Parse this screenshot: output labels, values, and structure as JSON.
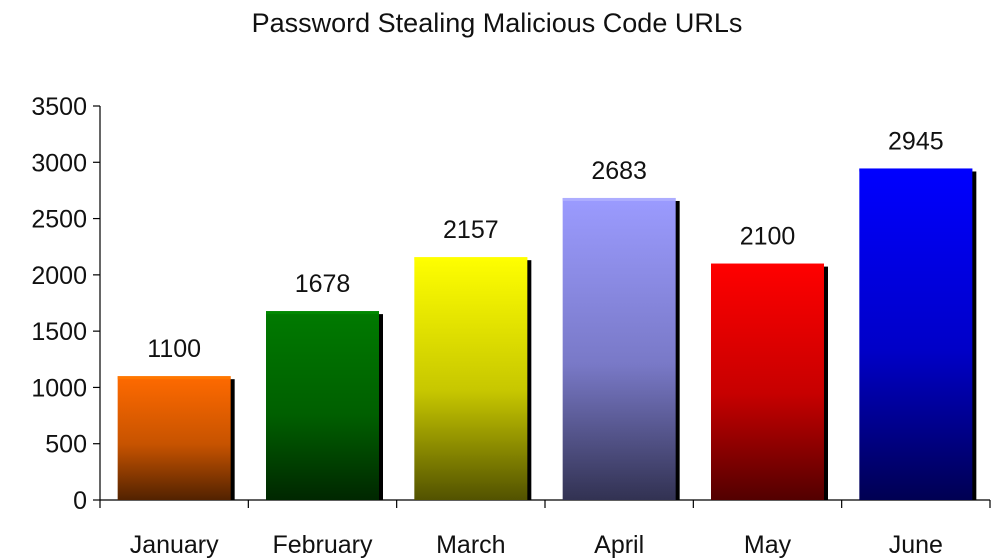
{
  "chart_data": {
    "type": "bar",
    "title": "Password Stealing Malicious Code URLs",
    "categories": [
      "January",
      "February",
      "March",
      "April",
      "May",
      "June"
    ],
    "values": [
      1100,
      1678,
      2157,
      2683,
      2100,
      2945
    ],
    "data_labels": [
      "1100",
      "1678",
      "2157",
      "2683",
      "2100",
      "2945"
    ],
    "ylim": [
      0,
      3500
    ],
    "yticks": [
      0,
      500,
      1000,
      1500,
      2000,
      2500,
      3000,
      3500
    ],
    "ytick_labels": [
      "0",
      "500",
      "1000",
      "1500",
      "2000",
      "2500",
      "3000",
      "3500"
    ],
    "xlabel": "",
    "ylabel": "",
    "grid": false,
    "legend": "none",
    "bar_colors": [
      "#ff6a00",
      "#007a00",
      "#ffff00",
      "#9b9bff",
      "#ff0000",
      "#0000ff"
    ]
  }
}
